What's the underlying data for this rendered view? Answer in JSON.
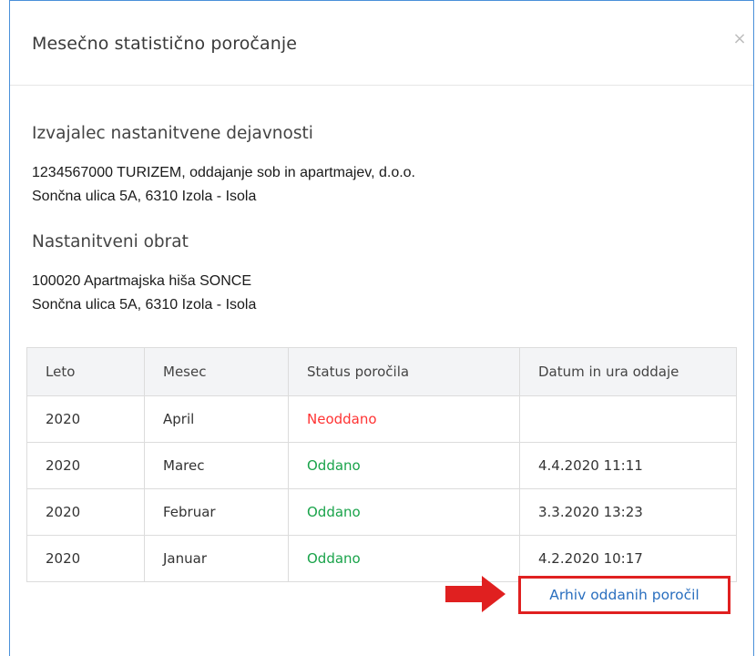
{
  "modal": {
    "title": "Mesečno statistično poročanje",
    "close_label": "×"
  },
  "provider": {
    "heading": "Izvajalec nastanitvene dejavnosti",
    "line1": "1234567000 TURIZEM, oddajanje sob in apartmajev, d.o.o.",
    "line2": "Sončna ulica 5A, 6310 Izola - Isola"
  },
  "establishment": {
    "heading": "Nastanitveni obrat",
    "line1": "100020 Apartmajska hiša SONCE",
    "line2": "Sončna ulica 5A, 6310 Izola - Isola"
  },
  "table": {
    "headers": [
      "Leto",
      "Mesec",
      "Status poročila",
      "Datum in ura oddaje"
    ],
    "rows": [
      {
        "year": "2020",
        "month": "April",
        "status": "Neoddano",
        "status_type": "not_submitted",
        "submitted_at": ""
      },
      {
        "year": "2020",
        "month": "Marec",
        "status": "Oddano",
        "status_type": "submitted",
        "submitted_at": "4.4.2020 11:11"
      },
      {
        "year": "2020",
        "month": "Februar",
        "status": "Oddano",
        "status_type": "submitted",
        "submitted_at": "3.3.2020 13:23"
      },
      {
        "year": "2020",
        "month": "Januar",
        "status": "Oddano",
        "status_type": "submitted",
        "submitted_at": "4.2.2020 10:17"
      }
    ]
  },
  "archive_link": {
    "label": "Arhiv oddanih poročil"
  },
  "colors": {
    "accent_border": "#4a90d9",
    "status_not_submitted": "#ff3333",
    "status_submitted": "#19a34a",
    "highlight_red": "#e02020",
    "link_blue": "#2a6fbf"
  },
  "icons": {
    "close": "close-icon",
    "pointer": "red-arrow-icon"
  }
}
